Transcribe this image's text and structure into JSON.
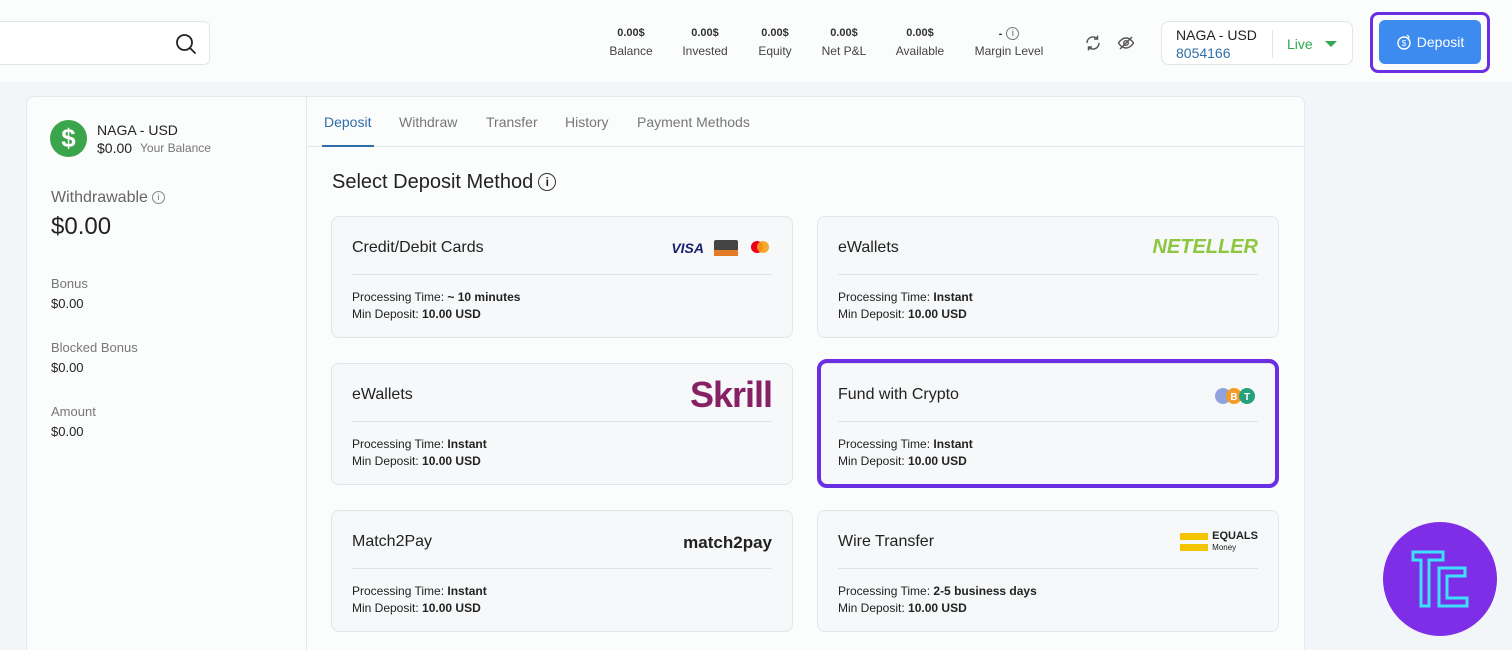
{
  "topbar": {
    "stats": [
      {
        "value": "0.00$",
        "label": "Balance"
      },
      {
        "value": "0.00$",
        "label": "Invested"
      },
      {
        "value": "0.00$",
        "label": "Equity"
      },
      {
        "value": "0.00$",
        "label": "Net P&L"
      },
      {
        "value": "0.00$",
        "label": "Available"
      },
      {
        "value": "-",
        "label": "Margin Level"
      }
    ],
    "account_name": "NAGA - USD",
    "account_number": "8054166",
    "mode": "Live",
    "deposit_label": "Deposit"
  },
  "sidebar": {
    "account_name": "NAGA - USD",
    "balance": "$0.00",
    "balance_label": "Your Balance",
    "withdrawable_label": "Withdrawable",
    "withdrawable_value": "$0.00",
    "items": [
      {
        "label": "Bonus",
        "value": "$0.00"
      },
      {
        "label": "Blocked Bonus",
        "value": "$0.00"
      },
      {
        "label": "Amount",
        "value": "$0.00"
      }
    ]
  },
  "tabs": [
    "Deposit",
    "Withdraw",
    "Transfer",
    "History",
    "Payment Methods"
  ],
  "section_title": "Select Deposit Method",
  "processing_label": "Processing Time:",
  "min_deposit_label": "Min Deposit:",
  "methods": [
    {
      "title": "Credit/Debit Cards",
      "logo": "VISA",
      "processing": "~ 10 minutes",
      "min": "10.00 USD"
    },
    {
      "title": "eWallets",
      "logo": "NETELLER",
      "processing": "Instant",
      "min": "10.00 USD"
    },
    {
      "title": "eWallets",
      "logo": "Skrill",
      "processing": "Instant",
      "min": "10.00 USD"
    },
    {
      "title": "Fund with Crypto",
      "logo": "crypto-coins",
      "processing": "Instant",
      "min": "10.00 USD"
    },
    {
      "title": "Match2Pay",
      "logo": "match2pay",
      "processing": "Instant",
      "min": "10.00 USD"
    },
    {
      "title": "Wire Transfer",
      "logo": "EQUALS",
      "logo_sub": "Money",
      "processing": "2-5 business days",
      "min": "10.00 USD"
    }
  ],
  "colors": {
    "accent": "#2f6fa8",
    "deposit_button": "#3d8bef",
    "highlight": "#6a2fe0",
    "live": "#2fa84f"
  }
}
